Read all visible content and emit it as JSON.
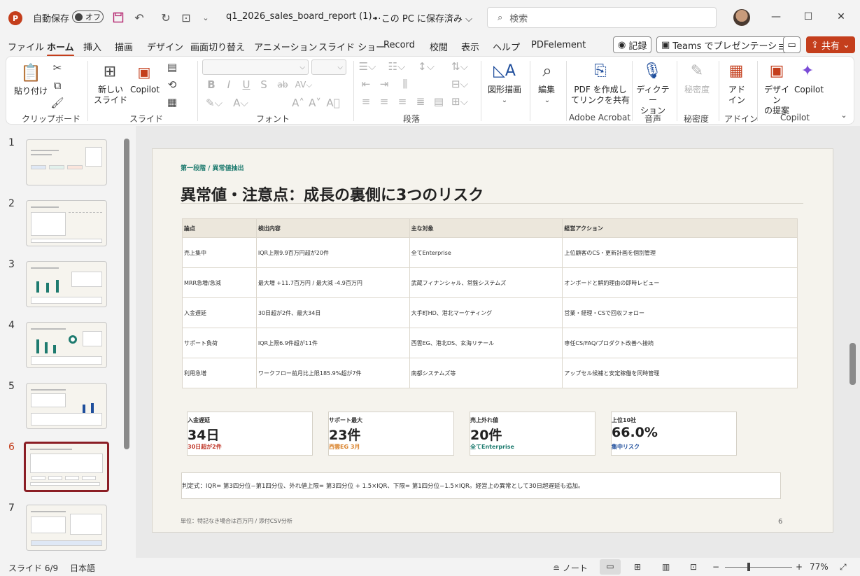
{
  "titlebar": {
    "autosave_label": "自動保存",
    "toggle_state": "オフ",
    "doc_title": "q1_2026_sales_board_report (1)…",
    "save_state": "• この PC に保存済み ⌵",
    "search_placeholder": "検索"
  },
  "tabs": [
    "ファイル",
    "ホーム",
    "挿入",
    "描画",
    "デザイン",
    "画面切り替え",
    "アニメーション",
    "スライド ショー",
    "Record",
    "校閲",
    "表示",
    "ヘルプ",
    "PDFelement"
  ],
  "topright": {
    "record": "記録",
    "teams": "Teams でプレゼンテーション",
    "share": "共有"
  },
  "ribbon": {
    "paste": "貼り付け",
    "clipboard": "クリップボード",
    "new_slide_1": "新しい",
    "new_slide_2": "スライド",
    "copilot": "Copilot",
    "slides_group": "スライド",
    "font_group": "フォント",
    "paragraph_group": "段落",
    "shapes_1": "図形描画",
    "edit": "編集",
    "pdf_1": "PDF を作成し",
    "pdf_2": "てリンクを共有",
    "adobe_group": "Adobe Acrobat",
    "dictate_1": "ディクテー",
    "dictate_2": "ション",
    "voice_group": "音声",
    "sensitivity": "秘密度",
    "sensitivity_group": "秘密度",
    "addin_1": "アド",
    "addin_2": "イン",
    "addin_group": "アドイン",
    "designer_1": "デザイン",
    "designer_2": "の提案",
    "copilot2": "Copilot",
    "copilot_group": "Copilot"
  },
  "thumbnails": [
    {
      "num": "1"
    },
    {
      "num": "2"
    },
    {
      "num": "3"
    },
    {
      "num": "4"
    },
    {
      "num": "5"
    },
    {
      "num": "6"
    },
    {
      "num": "7"
    }
  ],
  "slide": {
    "crumb": "第一段階 / 異常値抽出",
    "title": "異常値・注意点：成長の裏側に3つのリスク",
    "headers": [
      "論点",
      "検出内容",
      "主な対象",
      "経営アクション"
    ],
    "rows": [
      [
        "売上集中",
        "IQR上限9.9百万円超が20件",
        "全てEnterprise",
        "上位顧客のCS・更新計画を個別管理"
      ],
      [
        "MRR急増/急減",
        "最大増 +11.7百万円 / 最大減 -4.9百万円",
        "武蔵フィナンシャル、常盤システムズ",
        "オンボードと解約理由の即時レビュー"
      ],
      [
        "入金遅延",
        "30日超が2件、最大34日",
        "大手町HD、港北マーケティング",
        "営業・経理・CSで回収フォロー"
      ],
      [
        "サポート負荷",
        "IQR上限6.9件超が11件",
        "西雲EG、港北DS、玄海リテール",
        "専任CS/FAQ/プロダクト改善へ接続"
      ],
      [
        "利用急増",
        "ワークフロー前月比上限185.9%超が7件",
        "南都システムズ等",
        "アップセル候補と安定稼働を同時管理"
      ]
    ],
    "kpis": [
      {
        "label": "入金遅延",
        "value": "34日",
        "sub": "30日超が2件",
        "color": "#c0392b"
      },
      {
        "label": "サポート最大",
        "value": "23件",
        "sub": "西雲EG 3月",
        "color": "#d9822b"
      },
      {
        "label": "売上外れ値",
        "value": "20件",
        "sub": "全てEnterprise",
        "color": "#1e7b6f"
      },
      {
        "label": "上位10社",
        "value": "66.0%",
        "sub": "集中リスク",
        "color": "#1f4e9c"
      }
    ],
    "formula": "判定式：IQR= 第3四分位−第1四分位、外れ値上限= 第3四分位 + 1.5×IQR、下限= 第1四分位−1.5×IQR。経営上の異常として30日超遅延も追加。",
    "footnote": "単位：特記なき場合は百万円 / 添付CSV分析",
    "page": "6"
  },
  "status": {
    "slide_count": "スライド 6/9",
    "language": "日本語",
    "notes": "ノート",
    "zoom": "77%"
  }
}
